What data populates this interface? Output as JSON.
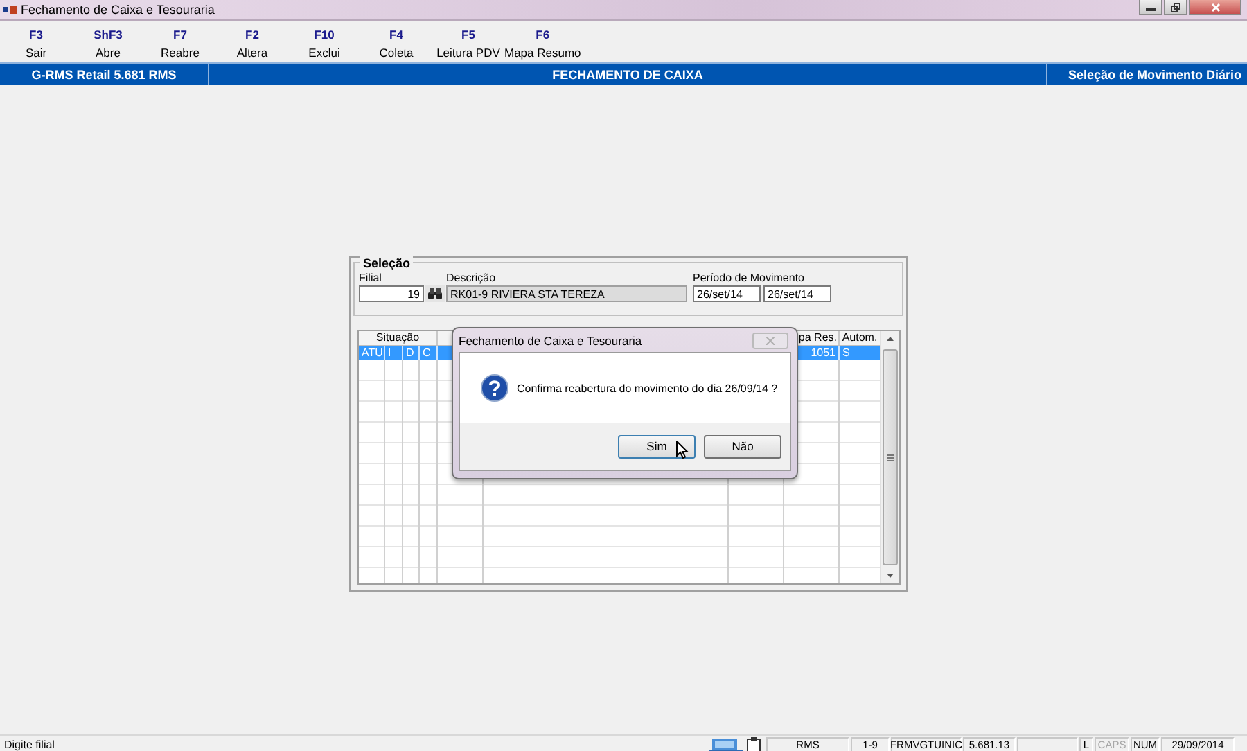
{
  "window": {
    "title": "Fechamento de Caixa e Tesouraria"
  },
  "toolbar": [
    {
      "key": "F3",
      "label": "Sair"
    },
    {
      "key": "ShF3",
      "label": "Abre"
    },
    {
      "key": "F7",
      "label": "Reabre"
    },
    {
      "key": "F2",
      "label": "Altera"
    },
    {
      "key": "F10",
      "label": "Exclui"
    },
    {
      "key": "F4",
      "label": "Coleta"
    },
    {
      "key": "F5",
      "label": "Leitura PDV"
    },
    {
      "key": "F6",
      "label": "Mapa Resumo"
    }
  ],
  "header_band": {
    "product": "G-RMS Retail 5.681 RMS",
    "module": "FECHAMENTO DE CAIXA",
    "screen": "Seleção de Movimento Diário"
  },
  "selecao": {
    "title": "Seleção",
    "filial_label": "Filial",
    "filial": "19",
    "descricao_label": "Descrição",
    "descricao": "RK01-9 RIVIERA STA TEREZA",
    "periodo_label": "Período de Movimento",
    "periodo_inicio": "26/set/14",
    "periodo_fim": "26/set/14"
  },
  "table": {
    "columns": [
      "Situação",
      "pa Res.",
      "Autom."
    ],
    "rows": [
      {
        "cells": [
          [
            "ATU",
            "I",
            "D",
            "C"
          ],
          "1051",
          "S"
        ],
        "selected": true
      }
    ]
  },
  "dialog": {
    "title": "Fechamento de Caixa e Tesouraria",
    "message": "Confirma reabertura do movimento do dia 26/09/14 ?",
    "buttons": [
      "Sim",
      "Não"
    ]
  },
  "status_bar": {
    "message": "Digite filial",
    "panels": [
      {
        "text": "RMS",
        "disabled": false
      },
      {
        "text": "1-9",
        "disabled": false
      },
      {
        "text": "FRMVGTUINIC",
        "disabled": false
      },
      {
        "text": "5.681.13",
        "disabled": false
      },
      {
        "disabled": false
      },
      {
        "text": "L",
        "disabled": false
      },
      {
        "text": "CAPS",
        "disabled": true
      },
      {
        "text": "NUM",
        "disabled": false
      },
      {
        "text": "29/09/2014",
        "disabled": false
      }
    ]
  }
}
